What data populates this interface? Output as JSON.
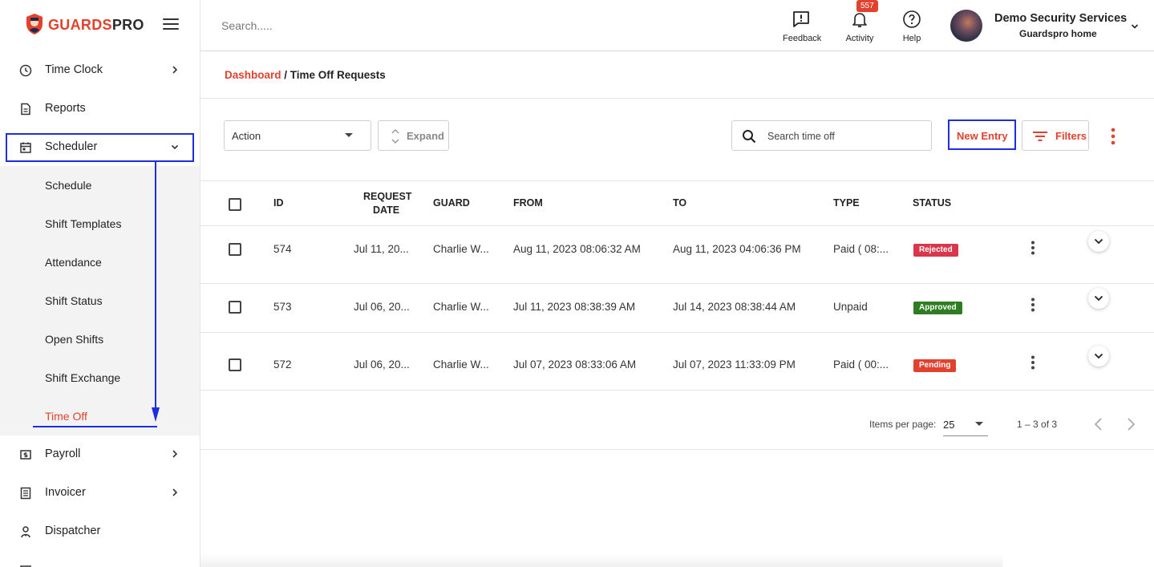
{
  "brand": {
    "name_part1": "GUARDS",
    "name_part2": "PRO",
    "accent_color": "#e2412d"
  },
  "sidebar": {
    "items": [
      {
        "label": "Time Clock",
        "icon": "clock-icon",
        "has_chevron": true
      },
      {
        "label": "Reports",
        "icon": "document-icon",
        "has_chevron": false
      },
      {
        "label": "Scheduler",
        "icon": "calendar-icon",
        "has_chevron": true,
        "expanded": true
      },
      {
        "label": "Payroll",
        "icon": "money-icon",
        "has_chevron": true
      },
      {
        "label": "Invoicer",
        "icon": "list-icon",
        "has_chevron": true
      },
      {
        "label": "Dispatcher",
        "icon": "person-icon",
        "has_chevron": false
      }
    ],
    "scheduler_submenu": [
      {
        "label": "Schedule"
      },
      {
        "label": "Shift Templates"
      },
      {
        "label": "Attendance"
      },
      {
        "label": "Shift Status"
      },
      {
        "label": "Open Shifts"
      },
      {
        "label": "Shift Exchange"
      },
      {
        "label": "Time Off",
        "active": true
      }
    ]
  },
  "topbar": {
    "search_placeholder": "Search.....",
    "feedback_label": "Feedback",
    "activity_label": "Activity",
    "activity_count": "557",
    "help_label": "Help",
    "user_name": "Demo Security Services",
    "user_subtitle": "Guardspro home"
  },
  "breadcrumb": {
    "link": "Dashboard",
    "separator": " / ",
    "current": "Time Off Requests"
  },
  "toolbar": {
    "action_label": "Action",
    "expand_label": "Expand",
    "search_placeholder": "Search time off",
    "new_entry_label": "New Entry",
    "filters_label": "Filters"
  },
  "table": {
    "headers": {
      "id": "ID",
      "request_date_1": "REQUEST",
      "request_date_2": "DATE",
      "guard": "GUARD",
      "from": "FROM",
      "to": "TO",
      "type": "TYPE",
      "status": "STATUS"
    },
    "rows": [
      {
        "id": "574",
        "request_date": "Jul 11, 20...",
        "guard": "Charlie W...",
        "from": "Aug 11, 2023 08:06:32 AM",
        "to": "Aug 11, 2023 04:06:36 PM",
        "type": "Paid ( 08:...",
        "status": "Rejected",
        "status_color": "#d9364b"
      },
      {
        "id": "573",
        "request_date": "Jul 06, 20...",
        "guard": "Charlie W...",
        "from": "Jul 11, 2023 08:38:39 AM",
        "to": "Jul 14, 2023 08:38:44 AM",
        "type": "Unpaid",
        "status": "Approved",
        "status_color": "#2e7d22"
      },
      {
        "id": "572",
        "request_date": "Jul 06, 20...",
        "guard": "Charlie W...",
        "from": "Jul 07, 2023 08:33:06 AM",
        "to": "Jul 07, 2023 11:33:09 PM",
        "type": "Paid ( 00:...",
        "status": "Pending",
        "status_color": "#e2412d"
      }
    ]
  },
  "paginator": {
    "items_per_page_label": "Items per page:",
    "page_size": "25",
    "range": "1 – 3 of 3"
  }
}
